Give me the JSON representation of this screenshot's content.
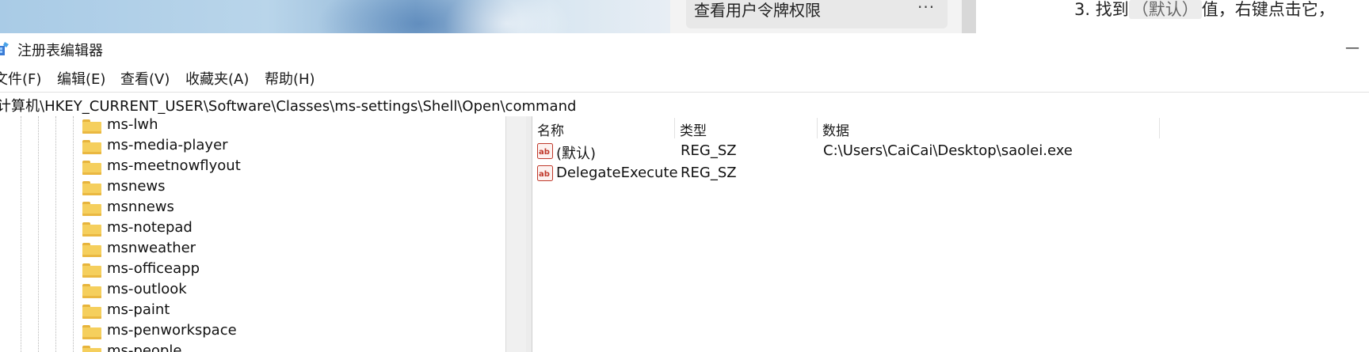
{
  "background": {
    "card_title": "查看用户令牌权限",
    "more_glyph": "···",
    "step_number": "3.",
    "step_find": "找到",
    "step_code": "（默认）",
    "step_rest": "值，右键点击它，"
  },
  "window": {
    "title": "注册表编辑器",
    "minimize_glyph": "—"
  },
  "menu": {
    "file": "文件(F)",
    "edit": "编辑(E)",
    "view": "查看(V)",
    "favorites": "收藏夹(A)",
    "help": "帮助(H)"
  },
  "address": {
    "path": "计算机\\HKEY_CURRENT_USER\\Software\\Classes\\ms-settings\\Shell\\Open\\command"
  },
  "tree": {
    "items": [
      "ms-lwh",
      "ms-media-player",
      "ms-meetnowflyout",
      "msnews",
      "msnnews",
      "ms-notepad",
      "msnweather",
      "ms-officeapp",
      "ms-outlook",
      "ms-paint",
      "ms-penworkspace",
      "ms-people"
    ]
  },
  "list": {
    "columns": {
      "name": "名称",
      "type": "类型",
      "data": "数据"
    },
    "rows": [
      {
        "name": "(默认)",
        "type": "REG_SZ",
        "data": "C:\\Users\\CaiCai\\Desktop\\saolei.exe"
      },
      {
        "name": "DelegateExecute",
        "type": "REG_SZ",
        "data": ""
      }
    ]
  },
  "colors": {
    "folder": "#f5cf5d",
    "ab_icon_red": "#c0392b"
  },
  "icons": {
    "app": "registry-editor-icon",
    "folder": "folder-icon",
    "value": "string-value-icon"
  }
}
